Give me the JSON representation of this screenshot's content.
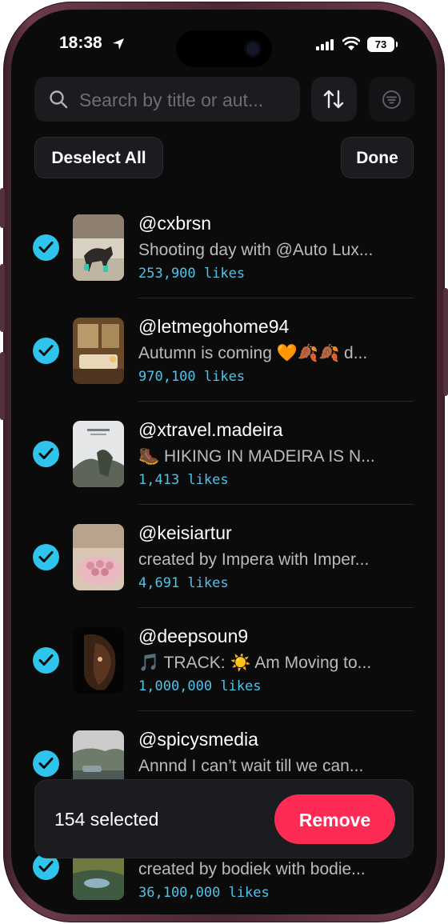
{
  "status_bar": {
    "time": "18:38",
    "battery": "73"
  },
  "search": {
    "placeholder": "Search by title or aut..."
  },
  "toolbar": {
    "deselect_label": "Deselect All",
    "done_label": "Done"
  },
  "items": [
    {
      "author": "@cxbrsn",
      "description": "Shooting day with @Auto Lux...",
      "likes": "253,900 likes"
    },
    {
      "author": "@letmegohome94",
      "description": "Autumn is coming 🧡🍂🍂 d...",
      "likes": "970,100 likes"
    },
    {
      "author": "@xtravel.madeira",
      "description": "🥾 HIKING IN MADEIRA IS N...",
      "likes": "1,413 likes"
    },
    {
      "author": "@keisiartur",
      "description": " created by Impera with Imper...",
      "likes": "4,691 likes"
    },
    {
      "author": "@deepsoun9",
      "description": "🎵 TRACK: ☀️ Am Moving to...",
      "likes": "1,000,000 likes"
    },
    {
      "author": "@spicysmedia",
      "description": "Annnd I can’t wait till we can...",
      "likes": ""
    },
    {
      "author": "",
      "description": " created by bodiek with bodie...",
      "likes": "36,100,000 likes"
    }
  ],
  "selection_bar": {
    "count_label": "154 selected",
    "remove_label": "Remove"
  },
  "colors": {
    "accent_check": "#2ec4ec",
    "likes_text": "#4fc3e8",
    "remove_button": "#fe2c55",
    "background": "#0b0b0c"
  }
}
